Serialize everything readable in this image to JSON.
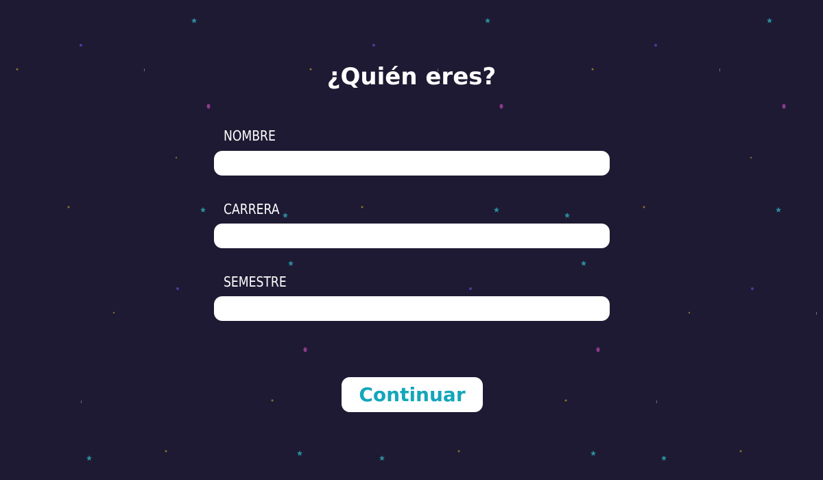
{
  "title": "¿Quién eres?",
  "form": {
    "fields": [
      {
        "label": "NOMBRE",
        "value": ""
      },
      {
        "label": "CARRERA",
        "value": ""
      },
      {
        "label": "SEMESTRE",
        "value": ""
      }
    ],
    "continue_label": "Continuar"
  },
  "colors": {
    "background": "#1e1a33",
    "input_bg": "#ffffff",
    "button_text": "#13a6bb",
    "star_teal": "#2a8a9a",
    "star_purple": "#8a3a8a",
    "star_blue": "#4a3a9a",
    "star_gold": "#8a7030"
  }
}
